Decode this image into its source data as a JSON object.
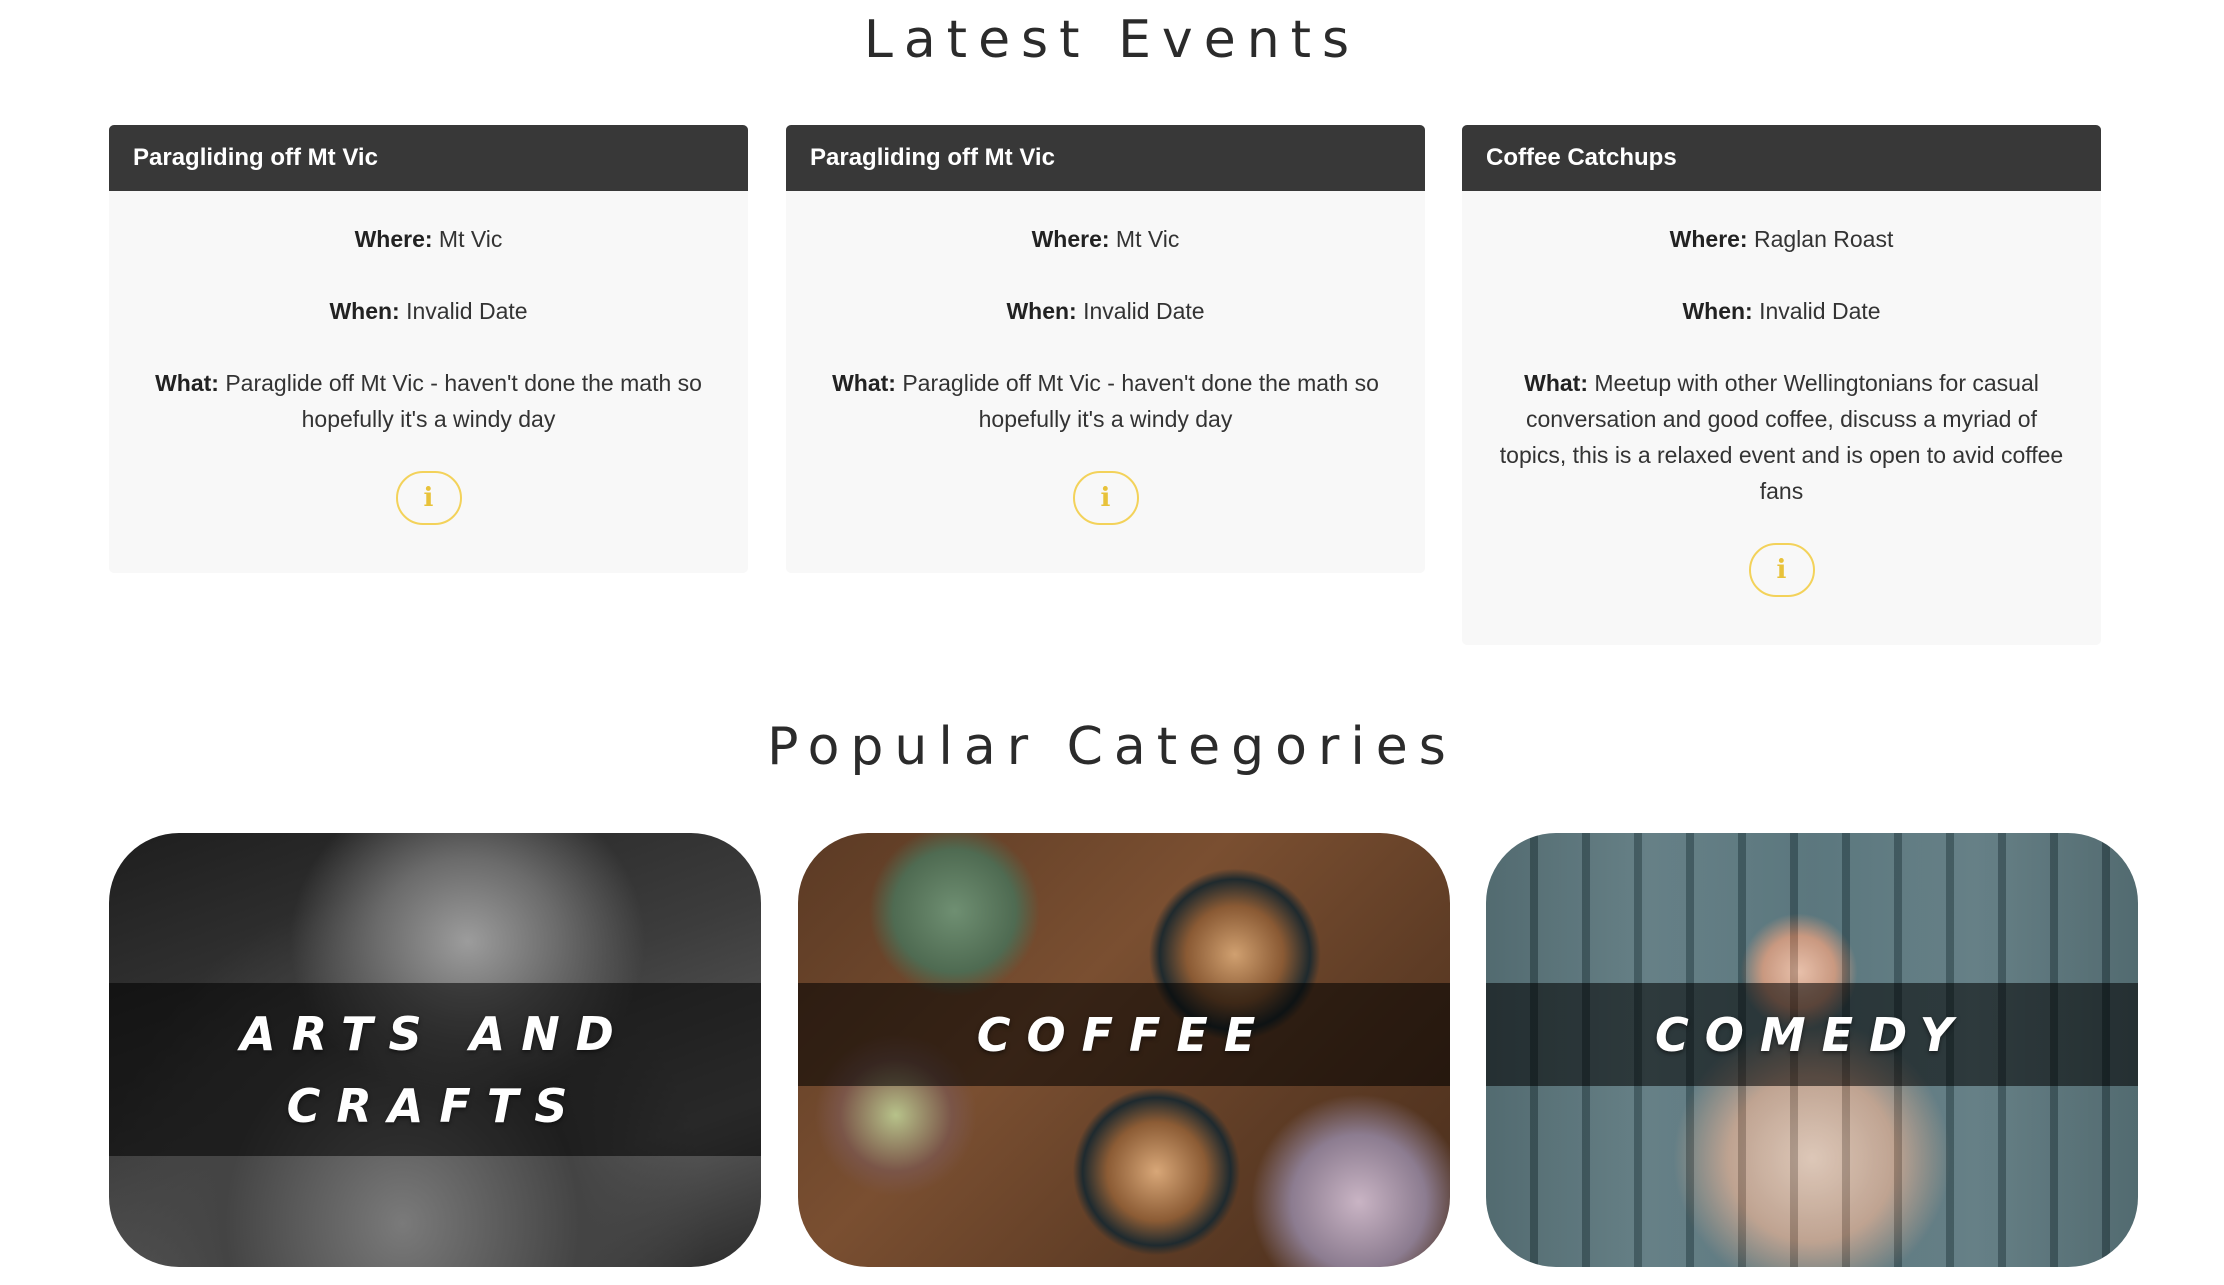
{
  "latest_events": {
    "title": "Latest Events",
    "labels": {
      "where": "Where:",
      "when": "When:",
      "what": "What:"
    },
    "info_icon": "info-icon",
    "accent_color": "#f3d25a",
    "events": [
      {
        "name": "Paragliding off Mt Vic",
        "where": "Mt Vic",
        "when": "Invalid Date",
        "what": "Paraglide off Mt Vic - haven't done the math so hopefully it's a windy day"
      },
      {
        "name": "Paragliding off Mt Vic",
        "where": "Mt Vic",
        "when": "Invalid Date",
        "what": "Paraglide off Mt Vic - haven't done the math so hopefully it's a windy day"
      },
      {
        "name": "Coffee Catchups",
        "where": "Raglan Roast",
        "when": "Invalid Date",
        "what": "Meetup with other Wellingtonians for casual conversation and good coffee, discuss a myriad of topics, this is a relaxed event and is open to avid coffee fans"
      }
    ]
  },
  "popular_categories": {
    "title": "Popular Categories",
    "categories": [
      {
        "label": "Arts and Crafts"
      },
      {
        "label": "Coffee"
      },
      {
        "label": "Comedy"
      }
    ]
  },
  "colors": {
    "card_header": "#383838",
    "card_body": "#f8f8f8"
  }
}
